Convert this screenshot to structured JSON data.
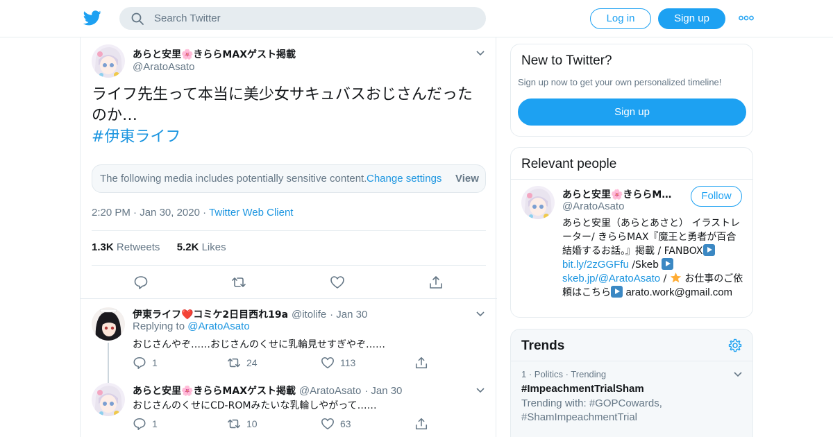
{
  "topbar": {
    "search_placeholder": "Search Twitter",
    "login_label": "Log in",
    "signup_label": "Sign up",
    "brand_color": "#1da1f2"
  },
  "tweet": {
    "author_name": "あらと安里🌸きららMAXゲスト掲載",
    "author_handle": "@AratoAsato",
    "text": "ライフ先生って本当に美少女サキュバスおじさんだったのか…",
    "hashtag": "#伊東ライフ",
    "sensitive_message": "The following media includes potentially sensitive content.",
    "change_settings_label": "Change settings",
    "view_label": "View",
    "time": "2:20 PM",
    "date": "Jan 30, 2020",
    "client": "Twitter Web Client",
    "retweets_count": "1.3K",
    "retweets_label": "Retweets",
    "likes_count": "5.2K",
    "likes_label": "Likes"
  },
  "replies": [
    {
      "author_name": "伊東ライフ❤️コミケ2日目西れ19a",
      "author_handle": "@itolife",
      "date": "Jan 30",
      "replying_to_label": "Replying to",
      "replying_to_handle": "@AratoAsato",
      "text": "おじさんやぞ……おじさんのくせに乳輪見せすぎやぞ……",
      "reply_count": "1",
      "retweet_count": "24",
      "like_count": "113"
    },
    {
      "author_name": "あらと安里🌸きららMAXゲスト掲載",
      "author_handle": "@AratoAsato",
      "date": "Jan 30",
      "text": "おじさんのくせにCD-ROMみたいな乳輪しやがって……",
      "reply_count": "1",
      "retweet_count": "10",
      "like_count": "63"
    }
  ],
  "sidebar": {
    "new_to_twitter": {
      "title": "New to Twitter?",
      "subtitle": "Sign up now to get your own personalized timeline!",
      "signup_label": "Sign up"
    },
    "relevant_people": {
      "title": "Relevant people",
      "person_name": "あらと安里🌸きららM…",
      "person_handle": "@AratoAsato",
      "follow_label": "Follow",
      "bio_part1": "あらと安里（あらとあさと） イラストレーター/ きららMAX『魔王と勇者が百合結婚するお話。』掲載 / FANBOX",
      "bio_link1": "bit.ly/2zGGFfu",
      "bio_part2": " /Skeb",
      "bio_link2": "skeb.jp/@AratoAsato",
      "bio_part3": " / ",
      "bio_part4": " お仕事のご依頼はこちら",
      "bio_email": "arato.work@gmail.com"
    },
    "trends": {
      "title": "Trends",
      "items": [
        {
          "rank": "1",
          "category": "Politics",
          "status": "Trending",
          "name": "#ImpeachmentTrialSham",
          "trending_with": "Trending with: #GOPCowards, #ShamImpeachmentTrial"
        }
      ]
    }
  }
}
